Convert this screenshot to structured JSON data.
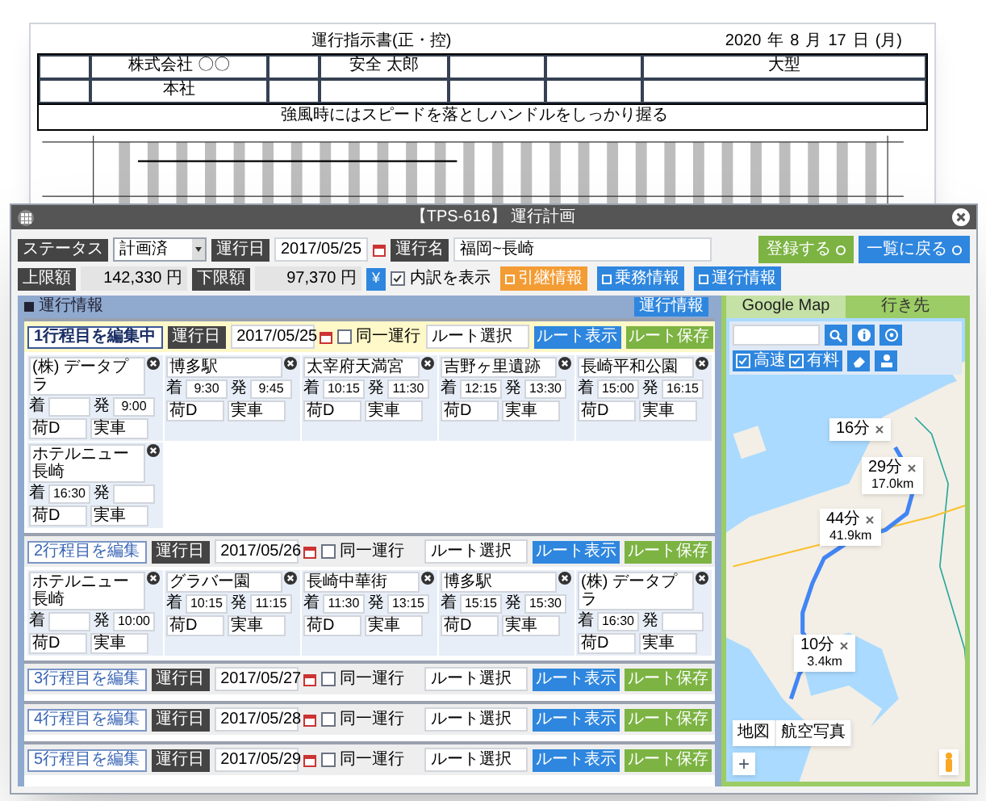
{
  "document": {
    "title": "運行指示書(正・控)",
    "date": [
      {
        "value": "2020",
        "unit": "年"
      },
      {
        "value": "8",
        "unit": "月"
      },
      {
        "value": "17",
        "unit": "日"
      },
      {
        "value": "(月)"
      }
    ],
    "company": "株式会社 〇〇",
    "office": "本社",
    "driver": "安全 太郎",
    "vehicle": "大型",
    "slogan": "強風時にはスピードを落としハンドルをしっかり握る"
  },
  "window": {
    "title": "【TPS-616】 運行計画"
  },
  "form": {
    "status": {
      "label": "ステータス",
      "value": "計画済"
    },
    "date": {
      "label": "運行日",
      "value": "2017/05/25"
    },
    "name": {
      "label": "運行名",
      "value": "福岡~長崎"
    },
    "upper": {
      "label": "上限額",
      "value": "142,330",
      "unit": "円"
    },
    "lower": {
      "label": "下限額",
      "value": "97,370",
      "unit": "円"
    },
    "yen": "¥",
    "breakdown": {
      "label": "内訳を表示",
      "checked": true
    },
    "tools": [
      {
        "label": "引継情報",
        "kind": "orange"
      },
      {
        "label": "乗務情報",
        "kind": "blue"
      },
      {
        "label": "運行情報",
        "kind": "blue"
      }
    ],
    "actions": [
      {
        "label": "登録する",
        "kind": "green"
      },
      {
        "label": "一覧に戻る",
        "kind": "blue"
      }
    ]
  },
  "section": {
    "title": "運行情報",
    "button": "運行情報"
  },
  "days": [
    {
      "label": "1行程目を編集中",
      "selected": true,
      "date_label": "運行日",
      "date": "2017/05/25",
      "same_label": "同一運行",
      "same": false,
      "route": "ルート選択",
      "show": "ルート表示",
      "save": "ルート保存",
      "stops": [
        {
          "name": "(株) データプラ",
          "arrive_label": "着",
          "depart_label": "発",
          "depart": "9:00",
          "cargo": "荷D",
          "state": "実車"
        },
        {
          "name": "博多駅",
          "arrive_label": "着",
          "arrive": "9:30",
          "depart_label": "発",
          "depart": "9:45",
          "cargo": "荷D",
          "state": "実車"
        },
        {
          "name": "太宰府天満宮",
          "arrive_label": "着",
          "arrive": "10:15",
          "depart_label": "発",
          "depart": "11:30",
          "cargo": "荷D",
          "state": "実車"
        },
        {
          "name": "吉野ヶ里遺跡",
          "arrive_label": "着",
          "arrive": "12:15",
          "depart_label": "発",
          "depart": "13:30",
          "cargo": "荷D",
          "state": "実車"
        },
        {
          "name": "長崎平和公園",
          "arrive_label": "着",
          "arrive": "15:00",
          "depart_label": "発",
          "depart": "16:15",
          "cargo": "荷D",
          "state": "実車"
        },
        {
          "name": "ホテルニュー長崎",
          "arrive_label": "着",
          "arrive": "16:30",
          "depart_label": "発",
          "cargo": "荷D",
          "state": "実車"
        }
      ]
    },
    {
      "label": "2行程目を編集",
      "selected": false,
      "date_label": "運行日",
      "date": "2017/05/26",
      "same_label": "同一運行",
      "same": false,
      "route": "ルート選択",
      "show": "ルート表示",
      "save": "ルート保存",
      "stops": [
        {
          "name": "ホテルニュー長崎",
          "arrive_label": "着",
          "depart_label": "発",
          "depart": "10:00",
          "cargo": "荷D",
          "state": "実車"
        },
        {
          "name": "グラバー園",
          "arrive_label": "着",
          "arrive": "10:15",
          "depart_label": "発",
          "depart": "11:15",
          "cargo": "荷D",
          "state": "実車"
        },
        {
          "name": "長崎中華街",
          "arrive_label": "着",
          "arrive": "11:30",
          "depart_label": "発",
          "depart": "13:15",
          "cargo": "荷D",
          "state": "実車"
        },
        {
          "name": "博多駅",
          "arrive_label": "着",
          "arrive": "15:15",
          "depart_label": "発",
          "depart": "15:30",
          "cargo": "荷D",
          "state": "実車"
        },
        {
          "name": "(株) データプラ",
          "arrive_label": "着",
          "arrive": "16:30",
          "depart_label": "発",
          "cargo": "荷D",
          "state": "実車"
        }
      ]
    },
    {
      "label": "3行程目を編集",
      "selected": false,
      "date_label": "運行日",
      "date": "2017/05/27",
      "same_label": "同一運行",
      "same": false,
      "route": "ルート選択",
      "show": "ルート表示",
      "save": "ルート保存"
    },
    {
      "label": "4行程目を編集",
      "selected": false,
      "date_label": "運行日",
      "date": "2017/05/28",
      "same_label": "同一運行",
      "same": false,
      "route": "ルート選択",
      "show": "ルート表示",
      "save": "ルート保存"
    },
    {
      "label": "5行程目を編集",
      "selected": false,
      "date_label": "運行日",
      "date": "2017/05/29",
      "same_label": "同一運行",
      "same": false,
      "route": "ルート選択",
      "show": "ルート表示",
      "save": "ルート保存"
    }
  ],
  "map_tabs": [
    {
      "label": "Google Map",
      "selected": true
    },
    {
      "label": "行き先",
      "selected": false
    }
  ],
  "map": {
    "toggles": [
      {
        "label": "高速",
        "checked": true
      },
      {
        "label": "有料",
        "checked": true
      }
    ],
    "bubbles": [
      {
        "time": "16分"
      },
      {
        "time": "29分",
        "distance": "17.0km"
      },
      {
        "time": "44分",
        "distance": "41.9km"
      },
      {
        "time": "10分",
        "distance": "3.4km"
      }
    ],
    "types": [
      "地図",
      "航空写真"
    ],
    "zoom": "+"
  }
}
